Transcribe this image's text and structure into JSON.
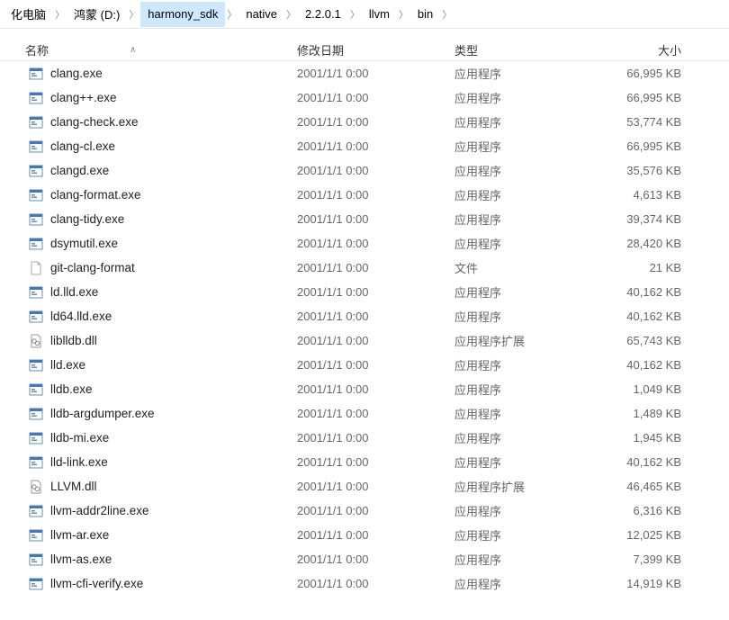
{
  "breadcrumb": [
    {
      "label": "化电脑",
      "active": false
    },
    {
      "label": "鸿蒙 (D:)",
      "active": false
    },
    {
      "label": "harmony_sdk",
      "active": true
    },
    {
      "label": "native",
      "active": false
    },
    {
      "label": "2.2.0.1",
      "active": false
    },
    {
      "label": "llvm",
      "active": false
    },
    {
      "label": "bin",
      "active": false
    }
  ],
  "columns": {
    "name": "名称",
    "date": "修改日期",
    "type": "类型",
    "size": "大小"
  },
  "fileTypes": {
    "exe": "应用程序",
    "dll": "应用程序扩展",
    "file": "文件"
  },
  "files": [
    {
      "name": "clang.exe",
      "date": "2001/1/1 0:00",
      "type": "exe",
      "size": "66,995 KB",
      "icon": "exe"
    },
    {
      "name": "clang++.exe",
      "date": "2001/1/1 0:00",
      "type": "exe",
      "size": "66,995 KB",
      "icon": "exe"
    },
    {
      "name": "clang-check.exe",
      "date": "2001/1/1 0:00",
      "type": "exe",
      "size": "53,774 KB",
      "icon": "exe"
    },
    {
      "name": "clang-cl.exe",
      "date": "2001/1/1 0:00",
      "type": "exe",
      "size": "66,995 KB",
      "icon": "exe"
    },
    {
      "name": "clangd.exe",
      "date": "2001/1/1 0:00",
      "type": "exe",
      "size": "35,576 KB",
      "icon": "exe"
    },
    {
      "name": "clang-format.exe",
      "date": "2001/1/1 0:00",
      "type": "exe",
      "size": "4,613 KB",
      "icon": "exe"
    },
    {
      "name": "clang-tidy.exe",
      "date": "2001/1/1 0:00",
      "type": "exe",
      "size": "39,374 KB",
      "icon": "exe"
    },
    {
      "name": "dsymutil.exe",
      "date": "2001/1/1 0:00",
      "type": "exe",
      "size": "28,420 KB",
      "icon": "exe"
    },
    {
      "name": "git-clang-format",
      "date": "2001/1/1 0:00",
      "type": "file",
      "size": "21 KB",
      "icon": "file"
    },
    {
      "name": "ld.lld.exe",
      "date": "2001/1/1 0:00",
      "type": "exe",
      "size": "40,162 KB",
      "icon": "exe"
    },
    {
      "name": "ld64.lld.exe",
      "date": "2001/1/1 0:00",
      "type": "exe",
      "size": "40,162 KB",
      "icon": "exe"
    },
    {
      "name": "liblldb.dll",
      "date": "2001/1/1 0:00",
      "type": "dll",
      "size": "65,743 KB",
      "icon": "dll"
    },
    {
      "name": "lld.exe",
      "date": "2001/1/1 0:00",
      "type": "exe",
      "size": "40,162 KB",
      "icon": "exe"
    },
    {
      "name": "lldb.exe",
      "date": "2001/1/1 0:00",
      "type": "exe",
      "size": "1,049 KB",
      "icon": "exe"
    },
    {
      "name": "lldb-argdumper.exe",
      "date": "2001/1/1 0:00",
      "type": "exe",
      "size": "1,489 KB",
      "icon": "exe"
    },
    {
      "name": "lldb-mi.exe",
      "date": "2001/1/1 0:00",
      "type": "exe",
      "size": "1,945 KB",
      "icon": "exe"
    },
    {
      "name": "lld-link.exe",
      "date": "2001/1/1 0:00",
      "type": "exe",
      "size": "40,162 KB",
      "icon": "exe"
    },
    {
      "name": "LLVM.dll",
      "date": "2001/1/1 0:00",
      "type": "dll",
      "size": "46,465 KB",
      "icon": "dll"
    },
    {
      "name": "llvm-addr2line.exe",
      "date": "2001/1/1 0:00",
      "type": "exe",
      "size": "6,316 KB",
      "icon": "exe"
    },
    {
      "name": "llvm-ar.exe",
      "date": "2001/1/1 0:00",
      "type": "exe",
      "size": "12,025 KB",
      "icon": "exe"
    },
    {
      "name": "llvm-as.exe",
      "date": "2001/1/1 0:00",
      "type": "exe",
      "size": "7,399 KB",
      "icon": "exe"
    },
    {
      "name": "llvm-cfi-verify.exe",
      "date": "2001/1/1 0:00",
      "type": "exe",
      "size": "14,919 KB",
      "icon": "exe"
    }
  ]
}
